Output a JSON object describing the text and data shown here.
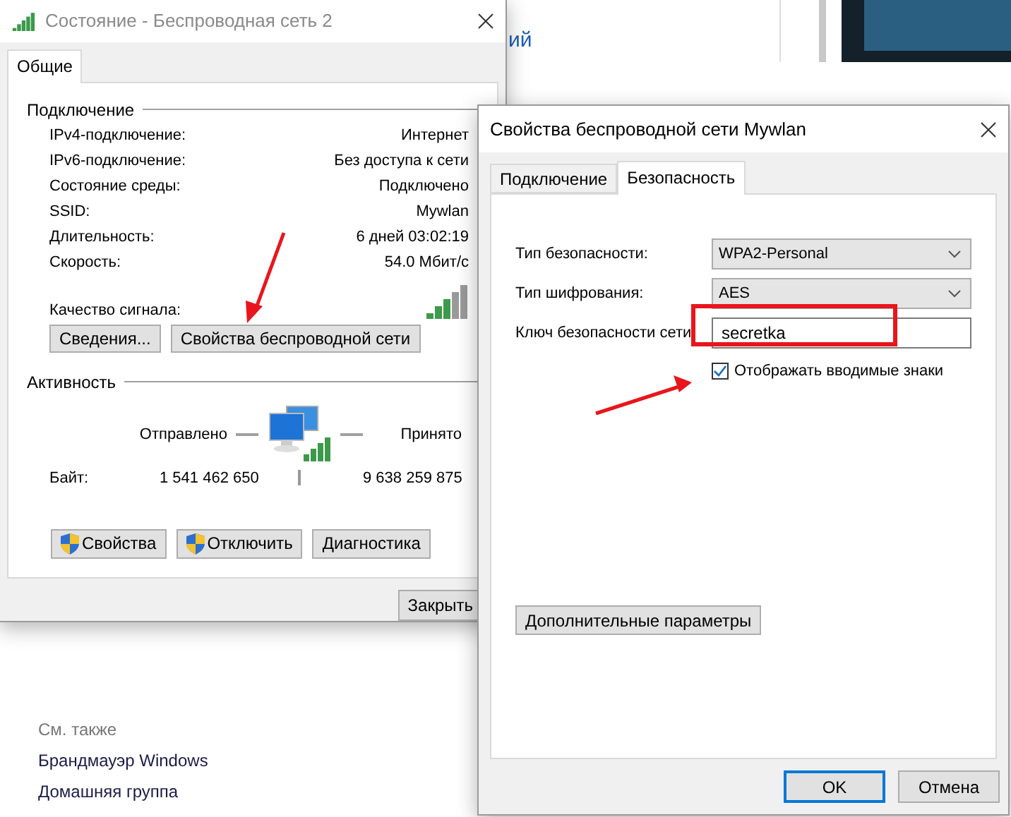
{
  "background": {
    "link_fragment": "ий",
    "see_also": {
      "title": "См. также",
      "links": [
        "Брандмауэр Windows",
        "Домашняя группа"
      ]
    }
  },
  "status_dialog": {
    "title": "Состояние - Беспроводная сеть 2",
    "tabs": [
      {
        "label": "Общие",
        "selected": true
      }
    ],
    "connection": {
      "heading": "Подключение",
      "rows": [
        {
          "label": "IPv4-подключение:",
          "value": "Интернет"
        },
        {
          "label": "IPv6-подключение:",
          "value": "Без доступа к сети"
        },
        {
          "label": "Состояние среды:",
          "value": "Подключено"
        },
        {
          "label": "SSID:",
          "value": "Mywlan"
        },
        {
          "label": "Длительность:",
          "value": "6 дней 03:02:19"
        },
        {
          "label": "Скорость:",
          "value": "54.0 Мбит/с"
        }
      ],
      "signal_label": "Качество сигнала:",
      "buttons": [
        "Сведения...",
        "Свойства беспроводной сети"
      ]
    },
    "activity": {
      "heading": "Активность",
      "sent_label": "Отправлено",
      "received_label": "Принято",
      "bytes_label": "Байт:",
      "sent": "1 541 462 650",
      "received": "9 638 259 875"
    },
    "buttons": [
      {
        "label": "Свойства",
        "shield": true
      },
      {
        "label": "Отключить",
        "shield": true
      },
      {
        "label": "Диагностика",
        "shield": false
      }
    ],
    "close_button": "Закрыть"
  },
  "properties_dialog": {
    "title": "Свойства беспроводной сети Mywlan",
    "tabs": [
      {
        "label": "Подключение",
        "selected": false
      },
      {
        "label": "Безопасность",
        "selected": true
      }
    ],
    "fields": [
      {
        "kind": "select",
        "label": "Тип безопасности:",
        "value": "WPA2-Personal"
      },
      {
        "kind": "select",
        "label": "Тип шифрования:",
        "value": "AES"
      },
      {
        "kind": "input",
        "label": "Ключ безопасности сети",
        "value": "secretka"
      }
    ],
    "show_chars": {
      "label": "Отображать вводимые знаки",
      "checked": true
    },
    "advanced_button": "Дополнительные параметры",
    "buttons": [
      {
        "label": "OK",
        "default": true
      },
      {
        "label": "Отмена",
        "default": false
      }
    ]
  }
}
